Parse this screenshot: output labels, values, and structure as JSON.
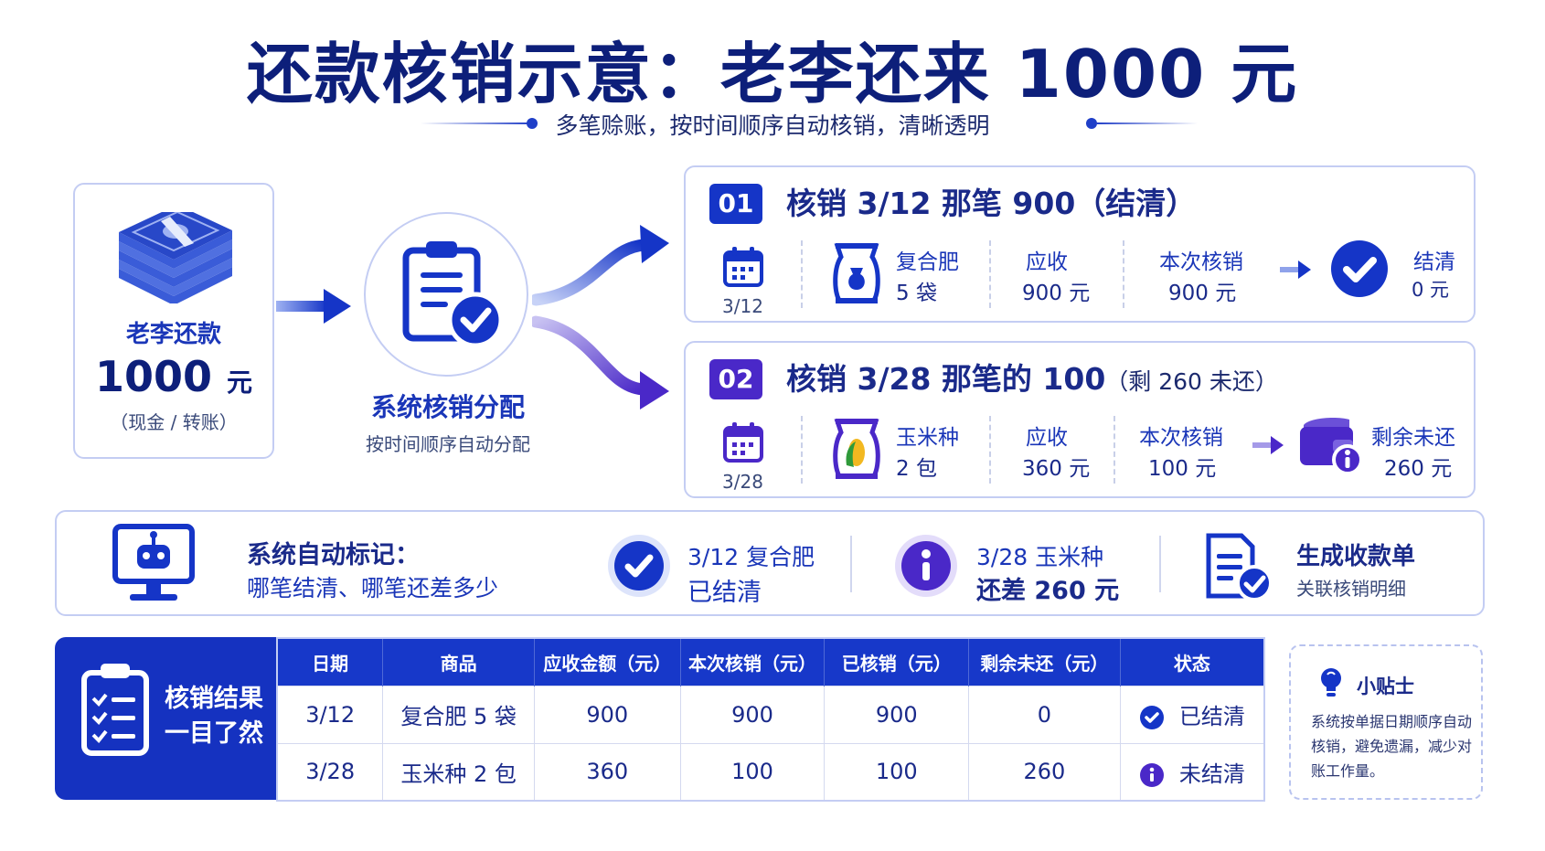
{
  "header": {
    "title": "还款核销示意：老李还来 1000 元",
    "subtitle": "多笔赊账，按时间顺序自动核销，清晰透明"
  },
  "payment": {
    "label": "老李还款",
    "amount": "1000",
    "unit": "元",
    "method": "（现金 / 转账）"
  },
  "system": {
    "title": "系统核销分配",
    "subtitle": "按时间顺序自动分配"
  },
  "entries": [
    {
      "badge": "01",
      "title": "核销 3/12 那笔  900（结清）",
      "note": "",
      "date": "3/12",
      "product_name": "复合肥",
      "product_qty": "5 袋",
      "receivable_label": "应收",
      "receivable_value": "900 元",
      "writeoff_label": "本次核销",
      "writeoff_value": "900 元",
      "result_label": "结清",
      "result_value": "0 元"
    },
    {
      "badge": "02",
      "title": "核销 3/28 那笔的 100",
      "note": "（剩 260 未还）",
      "date": "3/28",
      "product_name": "玉米种",
      "product_qty": "2 包",
      "receivable_label": "应收",
      "receivable_value": "360 元",
      "writeoff_label": "本次核销",
      "writeoff_value": "100 元",
      "result_label": "剩余未还",
      "result_value": "260 元"
    }
  ],
  "banner": {
    "title": "系统自动标记：",
    "subtitle": "哪笔结清、哪笔还差多少",
    "item1_line1": "3/12 复合肥",
    "item1_line2": "已结清",
    "item2_line1": "3/28 玉米种",
    "item2_line2": "还差 260 元",
    "item3_line1": "生成收款单",
    "item3_line2": "关联核销明细"
  },
  "result": {
    "label_line1": "核销结果",
    "label_line2": "一目了然"
  },
  "table": {
    "headers": [
      "日期",
      "商品",
      "应收金额（元）",
      "本次核销（元）",
      "已核销（元）",
      "剩余未还（元）",
      "状态"
    ],
    "rows": [
      {
        "date": "3/12",
        "product": "复合肥  5 袋",
        "receivable": "900",
        "writeoff": "900",
        "written": "900",
        "remaining": "0",
        "status": "已结清"
      },
      {
        "date": "3/28",
        "product": "玉米种  2 包",
        "receivable": "360",
        "writeoff": "100",
        "written": "100",
        "remaining": "260",
        "status": "未结清"
      }
    ]
  },
  "tip": {
    "title": "小贴士",
    "body": "系统按单据日期顺序自动核销，避免遗漏，减少对账工作量。"
  },
  "colors": {
    "primary": "#1535c7",
    "purple": "#4a28c8",
    "navy": "#0d1f7a"
  }
}
